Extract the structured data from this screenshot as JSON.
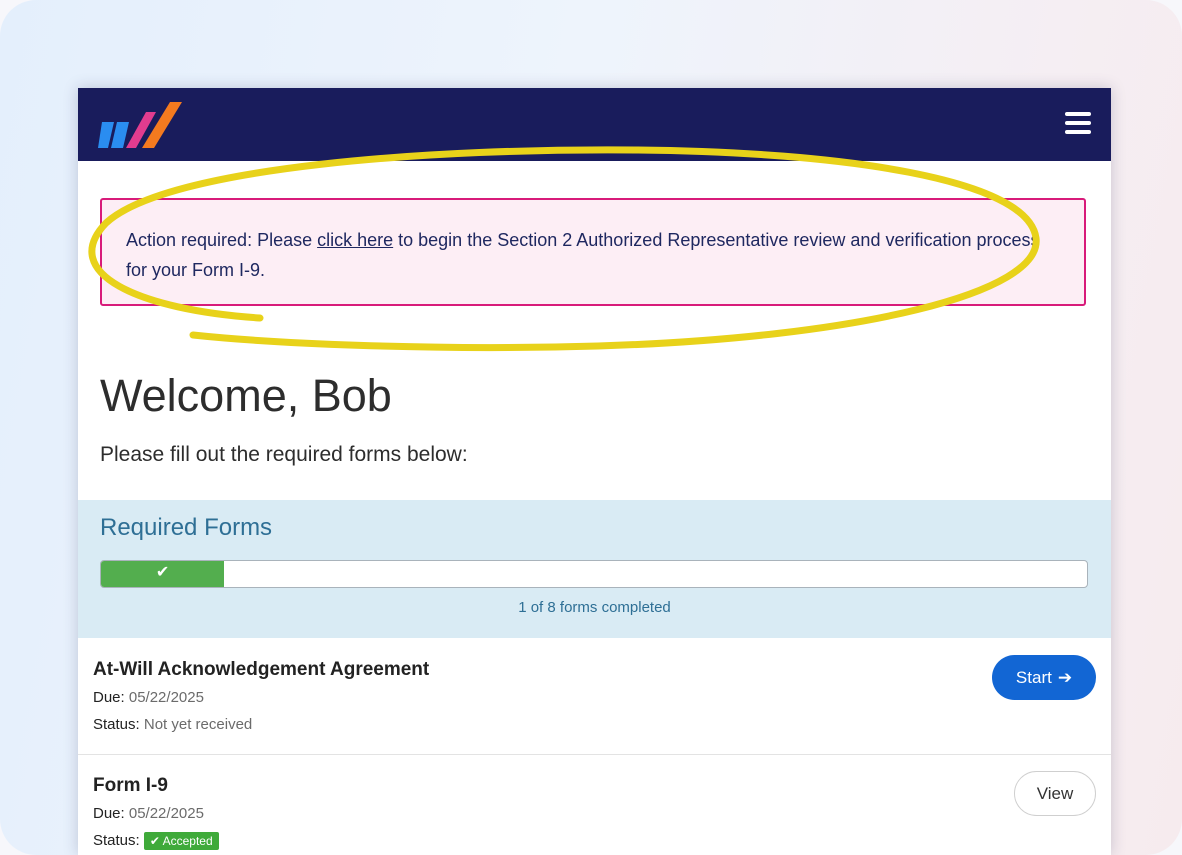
{
  "header": {
    "logo_icon": "brand-logo-icon",
    "menu_icon": "hamburger-menu-icon"
  },
  "alert": {
    "prefix": "Action required: Please ",
    "link_text": "click here",
    "suffix": " to begin the Section 2 Authorized Representative review and verification process for your Form I-9."
  },
  "welcome": {
    "title": "Welcome, Bob",
    "subtitle": "Please fill out the required forms below:"
  },
  "required_forms": {
    "heading": "Required Forms",
    "progress_fraction": 0.125,
    "progress_check": "✔",
    "progress_text": "1 of 8 forms completed"
  },
  "forms": [
    {
      "title": "At-Will Acknowledgement Agreement",
      "due_label": "Due:",
      "due": "05/22/2025",
      "status_label": "Status:",
      "status": "Not yet received",
      "action": "Start",
      "action_icon": "➔"
    },
    {
      "title": "Form I-9",
      "due_label": "Due:",
      "due": "05/22/2025",
      "status_label": "Status:",
      "status": "✔ Accepted",
      "action": "View"
    }
  ],
  "colors": {
    "topbar": "#191c5c",
    "alert_border": "#d81b7a",
    "progress_fill": "#53ae4e",
    "primary_button": "#1266d4",
    "highlight_stroke": "#e8d21a"
  }
}
